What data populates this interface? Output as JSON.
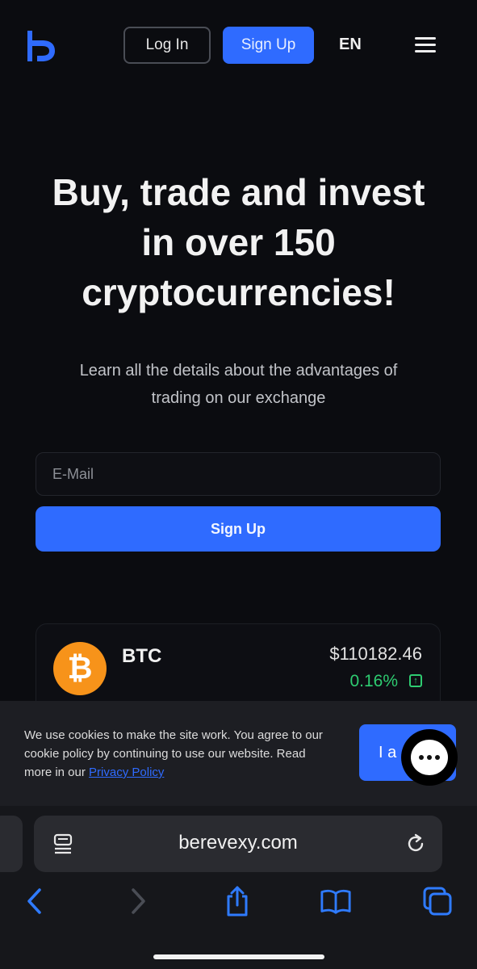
{
  "header": {
    "login_label": "Log In",
    "signup_label": "Sign Up",
    "language": "EN"
  },
  "hero": {
    "title_line1": "Buy, trade and invest",
    "title_line2": "in over 150",
    "title_line3": "cryptocurrencies!",
    "subtitle_line1": "Learn all the details about the advantages of",
    "subtitle_line2": "trading on our exchange"
  },
  "signup_form": {
    "email_placeholder": "E-Mail",
    "submit_label": "Sign Up"
  },
  "ticker": {
    "symbol": "BTC",
    "price": "$110182.46",
    "change": "0.16%"
  },
  "cookie_banner": {
    "text": "We use cookies to make the site work. You agree to our cookie policy by continuing to use our website. Read more in our ",
    "link_label": "Privacy Policy",
    "accept_label": "I a"
  },
  "browser": {
    "url": "berevexy.com"
  },
  "colors": {
    "accent": "#2f6bff",
    "background": "#0b0c10",
    "positive": "#2ecc71",
    "btc": "#f7931a"
  },
  "icons": [
    "logo-icon",
    "menu-icon",
    "bitcoin-icon",
    "arrow-up-icon",
    "chat-icon",
    "reader-icon",
    "reload-icon",
    "back-icon",
    "forward-icon",
    "share-icon",
    "bookmarks-icon",
    "tabs-icon"
  ]
}
